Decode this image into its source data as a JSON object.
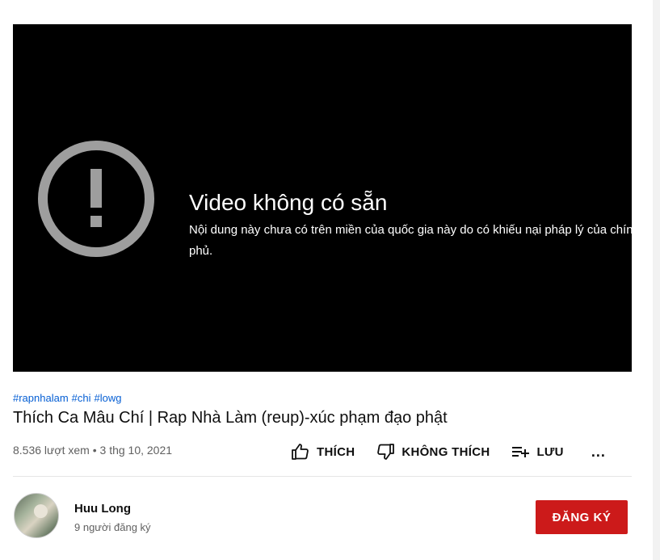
{
  "player": {
    "error_title": "Video không có sẵn",
    "error_message": "Nội dung này chưa có trên miền của quốc gia này do có khiếu nại pháp lý của chính phủ.",
    "icon": "alert-circle-icon"
  },
  "video": {
    "hashtags": [
      "#rapnhalam",
      "#chi",
      "#lowg"
    ],
    "title": "Thích Ca Mâu Chí | Rap Nhà Làm (reup)-xúc phạm đạo phật",
    "views": "8.536 lượt xem",
    "separator": "•",
    "date": "3 thg 10, 2021"
  },
  "actions": {
    "like_label": "THÍCH",
    "dislike_label": "KHÔNG THÍCH",
    "save_label": "LƯU",
    "more_label": "..."
  },
  "channel": {
    "name": "Huu Long",
    "subscribers": "9 người đăng ký",
    "subscribe_label": "ĐĂNG KÝ"
  },
  "colors": {
    "subscribe_bg": "#cc1a1a",
    "hashtag": "#065fd4",
    "player_bg": "#000000"
  }
}
